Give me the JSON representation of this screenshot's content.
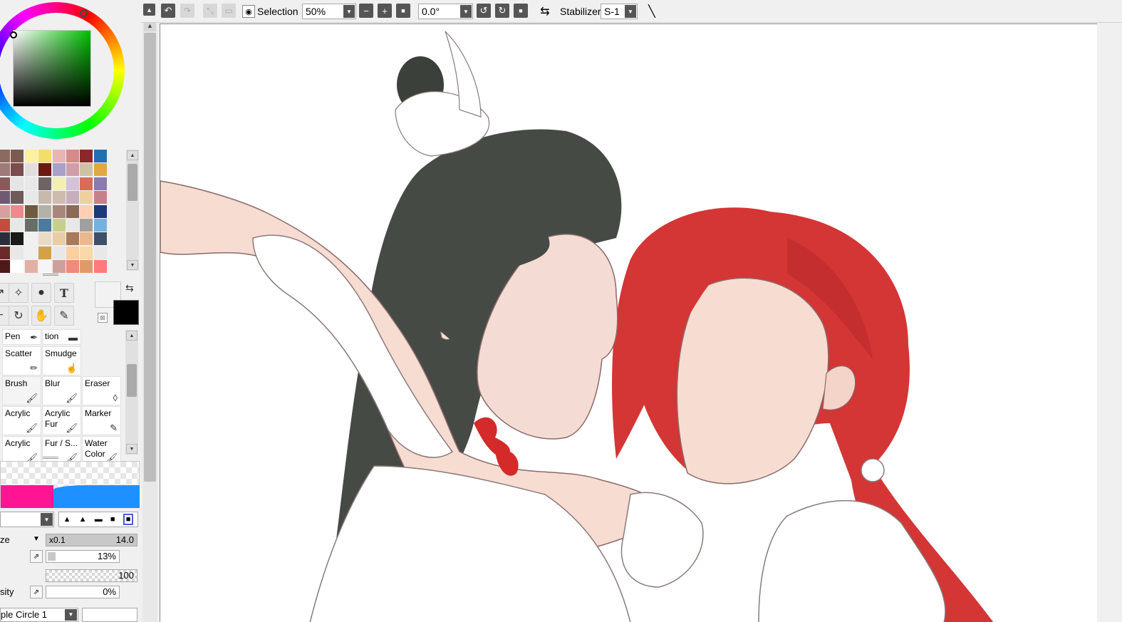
{
  "toolbar": {
    "selection_label": "Selection",
    "zoom_value": "50%",
    "rotation_value": "0.0°",
    "stabilizer_label": "Stabilizer",
    "stabilizer_value": "S-1"
  },
  "color_panel": {
    "primary_color": "#000000",
    "secondary_color": "#f2f2f2",
    "selected_hue": "#00aa00"
  },
  "palette": {
    "swatches": [
      "#8c6a60",
      "#7b5a50",
      "#faf2a0",
      "#f4de6a",
      "#e8b5b5",
      "#d68a8a",
      "#8a2828",
      "#1f6fb2",
      "#9e7a78",
      "#7a4c4c",
      "#e3dede",
      "#6a1a10",
      "#a8a0c8",
      "#cf9ea6",
      "#cfc1a6",
      "#e0a840",
      "#8a5a58",
      "#e5e5e5",
      "#e8e8e8",
      "#6e6466",
      "#f3eeb2",
      "#d3c2d8",
      "#dc6a5a",
      "#8a7ab0",
      "#6f5a72",
      "#6f5a5a",
      "#e8e8e8",
      "#c9b8ac",
      "#cfbab0",
      "#c7aebc",
      "#eecfa0",
      "#c7808a",
      "#d7a0a0",
      "#ed8a90",
      "#6e5a40",
      "#b2b2a8",
      "#a8877a",
      "#8a6a5a",
      "#ffcfb6",
      "#1a3a7a",
      "#c44c3c",
      "#e8e8e8",
      "#666e66",
      "#4a7aa0",
      "#c7d08a",
      "#e8e8e8",
      "#a0a0a0",
      "#74b2e2",
      "#2a2e3a",
      "#1a1a1a",
      "#f0f0f0",
      "#e9dac6",
      "#e8cda6",
      "#a87a5a",
      "#e8b890",
      "#3e5068",
      "#6a2a2a",
      "#e8e8e8",
      "#f0f0f0",
      "#d4a048",
      "#e8e8e8",
      "#ffcfa0",
      "#fbd8a8",
      "#e8e8e8",
      "#4a1a1a",
      "#ffffff",
      "#e3b0a6",
      "#f5f5f5",
      "#cea09a",
      "#f08a7a",
      "#e09a6a",
      "#ff7a7a"
    ]
  },
  "brushes": {
    "items": [
      {
        "label": "Pen",
        "icon": "pen-icon"
      },
      {
        "label": "tion",
        "icon": "gradation-icon"
      },
      {
        "label": "Scatter",
        "icon": "pencil-icon"
      },
      {
        "label": "Smudge",
        "icon": "smudge-icon"
      },
      {
        "label": "Brush",
        "icon": "brush-icon"
      },
      {
        "label": "Blur",
        "icon": "brush-icon"
      },
      {
        "label": "Eraser",
        "icon": "eraser-icon"
      },
      {
        "label": "Acrylic",
        "icon": "brush-icon"
      },
      {
        "label": "Acrylic Fur",
        "icon": "brush-icon"
      },
      {
        "label": "Marker",
        "icon": "marker-icon"
      },
      {
        "label": "Acrylic",
        "icon": "brush-icon"
      },
      {
        "label": "Fur / S...",
        "icon": "brush-icon"
      },
      {
        "label": "Water Color",
        "icon": "brush-icon"
      }
    ]
  },
  "settings": {
    "size_label": "ze",
    "size_multiplier": "x0.1",
    "size_value": "14.0",
    "min_size_value": "13%",
    "density_value": "100",
    "min_density_label": "sity",
    "min_density_value": "0%",
    "shape_value": "ple Circle 1"
  }
}
